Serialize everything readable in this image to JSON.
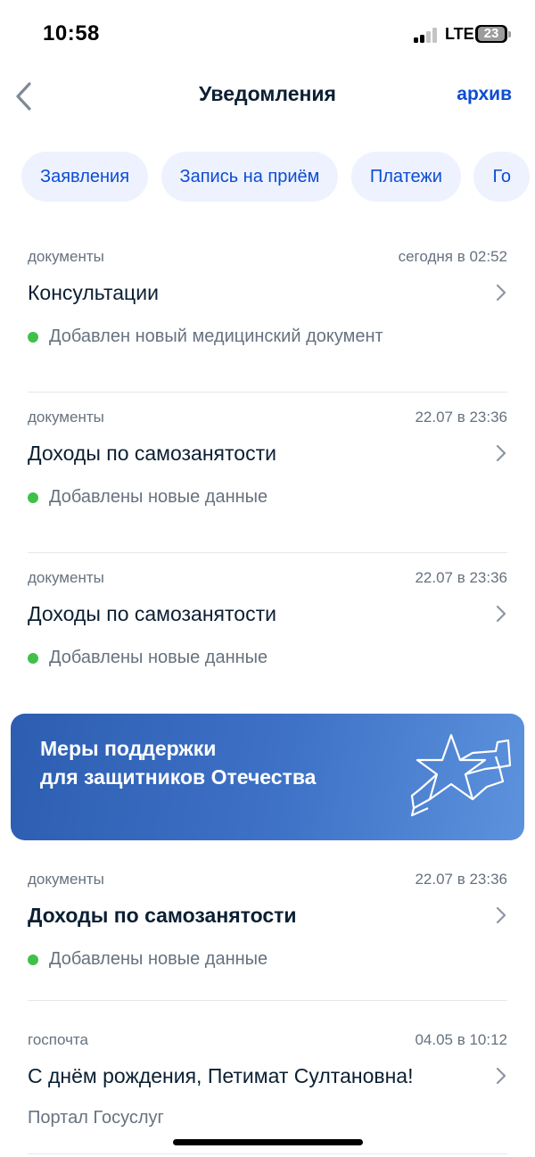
{
  "status_bar": {
    "time": "10:58",
    "network": "LTE",
    "battery_level": "23"
  },
  "header": {
    "title": "Уведомления",
    "archive_label": "архив"
  },
  "filters": [
    "Заявления",
    "Запись на приём",
    "Платежи",
    "Го"
  ],
  "notifications": [
    {
      "category": "документы",
      "date": "сегодня в 02:52",
      "title": "Консультации",
      "status": "Добавлен новый медицинский документ"
    },
    {
      "category": "документы",
      "date": "22.07 в 23:36",
      "title": "Доходы по самозанятости",
      "status": "Добавлены новые данные"
    },
    {
      "category": "документы",
      "date": "22.07 в 23:36",
      "title": "Доходы по самозанятости",
      "status": "Добавлены новые данные"
    },
    {
      "category": "документы",
      "date": "22.07 в 23:36",
      "title": "Доходы по самозанятости",
      "status": "Добавлены новые данные",
      "unread": true
    },
    {
      "category": "госпочта",
      "date": "04.05 в 10:12",
      "title": "С днём рождения, Петимат Султановна!",
      "source": "Портал Госуслуг"
    }
  ],
  "banner": {
    "line1": "Меры поддержки",
    "line2": "для защитников Отечества"
  },
  "colors": {
    "accent": "#0d4cd3",
    "chip_bg": "#edf2fe",
    "status_dot": "#3fc04a",
    "banner_start": "#2c5db1",
    "banner_end": "#5c92dd"
  }
}
